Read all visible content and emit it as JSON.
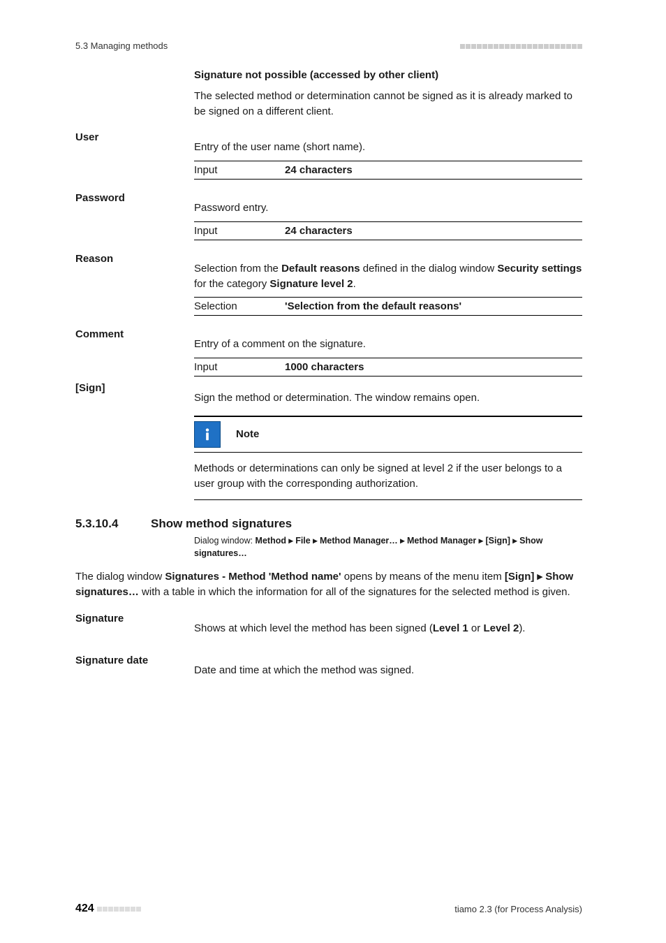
{
  "running_head": {
    "left": "5.3 Managing methods"
  },
  "intro": {
    "heading": "Signature not possible (accessed by other client)",
    "text": "The selected method or determination cannot be signed as it is already marked to be signed on a different client."
  },
  "user": {
    "label": "User",
    "desc": "Entry of the user name (short name).",
    "row_label": "Input",
    "row_value": "24 characters"
  },
  "password": {
    "label": "Password",
    "desc": "Password entry.",
    "row_label": "Input",
    "row_value": "24 characters"
  },
  "reason": {
    "label": "Reason",
    "desc_pre": "Selection from the ",
    "desc_bold1": "Default reasons",
    "desc_mid": " defined in the dialog window ",
    "desc_bold2": "Security settings",
    "desc_mid2": " for the category ",
    "desc_bold3": "Signature level 2",
    "desc_end": ".",
    "row_label": "Selection",
    "row_value": "'Selection from the default reasons'"
  },
  "comment": {
    "label": "Comment",
    "desc": "Entry of a comment on the signature.",
    "row_label": "Input",
    "row_value": "1000 characters"
  },
  "sign": {
    "label": "[Sign]",
    "desc": "Sign the method or determination. The window remains open."
  },
  "note": {
    "title": "Note",
    "text": "Methods or determinations can only be signed at level 2 if the user belongs to a user group with the corresponding authorization."
  },
  "chapter": {
    "num": "5.3.10.4",
    "title": "Show method signatures",
    "path_pre": "Dialog window: ",
    "path": "Method ▸ File ▸ Method Manager… ▸ Method Manager ▸ [Sign] ▸ Show signatures…",
    "p1_pre": "The dialog window ",
    "p1_bold1": "Signatures - Method 'Method name'",
    "p1_mid": " opens by means of the menu item ",
    "p1_bold2": "[Sign] ▸ Show signatures…",
    "p1_end": " with a table in which the information for all of the signatures for the selected method is given."
  },
  "signature": {
    "label": "Signature",
    "desc_pre": "Shows at which level the method has been signed (",
    "desc_bold1": "Level 1",
    "desc_mid": " or ",
    "desc_bold2": "Level 2",
    "desc_end": ")."
  },
  "signature_date": {
    "label": "Signature date",
    "desc": "Date and time at which the method was signed."
  },
  "footer": {
    "page": "424",
    "product": "tiamo 2.3 (for Process Analysis)"
  }
}
